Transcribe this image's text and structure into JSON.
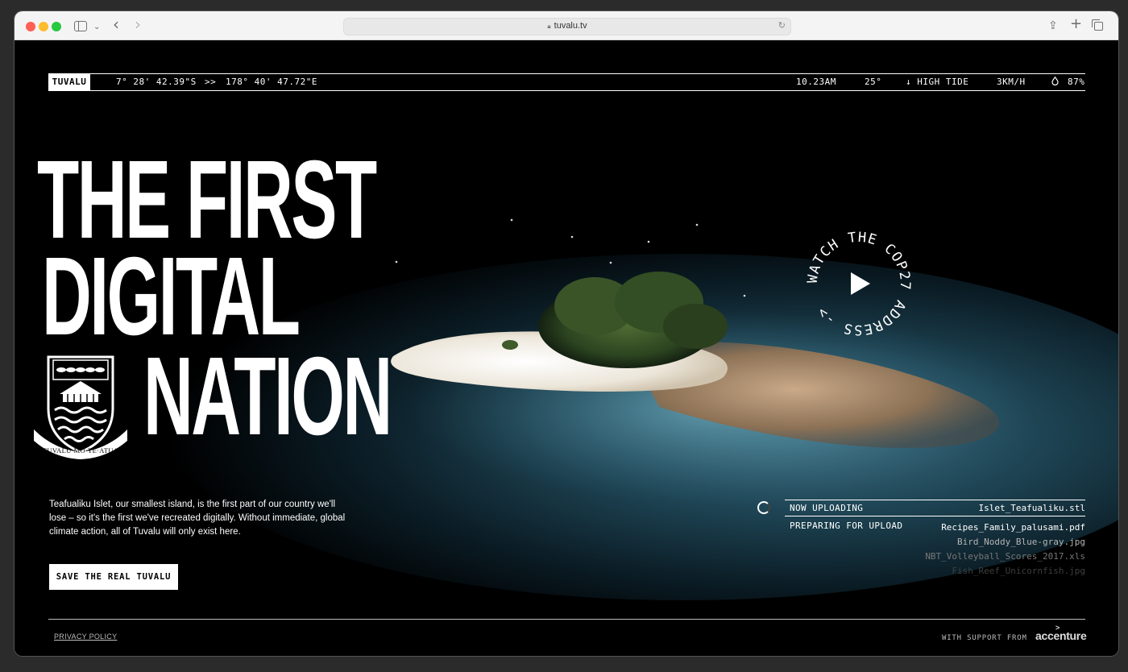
{
  "browser": {
    "url": "tuvalu.tv"
  },
  "topbar": {
    "country": "TUVALU",
    "latitude": "7° 28' 42.39\"S",
    "separator": ">>",
    "longitude": "178° 40' 47.72\"E",
    "time": "10.23AM",
    "temperature": "25°",
    "tide": "↓ HIGH TIDE",
    "wind": "3KM/H",
    "humidity_icon": "droplet-icon",
    "humidity": "87%"
  },
  "hero": {
    "line1": "THE FIRST",
    "line2": "DIGITAL",
    "line3": "NATION",
    "crest_motto": "TUVALU·MO·TE·ATUA",
    "body": "Teafualiku Islet, our smallest island, is the first part of our country we'll lose – so it's the first we've recreated digitally. Without immediate, global climate action, all of Tuvalu will only exist here.",
    "cta": "SAVE THE REAL TUVALU"
  },
  "watch": {
    "ring_text": "WATCH THE COP27 ADDRESS ->"
  },
  "upload": {
    "now_label": "NOW UPLOADING",
    "now_file": "Islet_Teafualiku.stl",
    "prep_label": "PREPARING FOR UPLOAD",
    "queue": [
      "Recipes_Family_palusami.pdf",
      "Bird_Noddy_Blue-gray.jpg",
      "NBT_Volleyball_Scores_2017.xls",
      "Fish_Reef_Unicornfish.jpg"
    ]
  },
  "footer": {
    "privacy": "PRIVACY POLICY",
    "support": "WITH SUPPORT FROM",
    "sponsor": "accenture"
  }
}
